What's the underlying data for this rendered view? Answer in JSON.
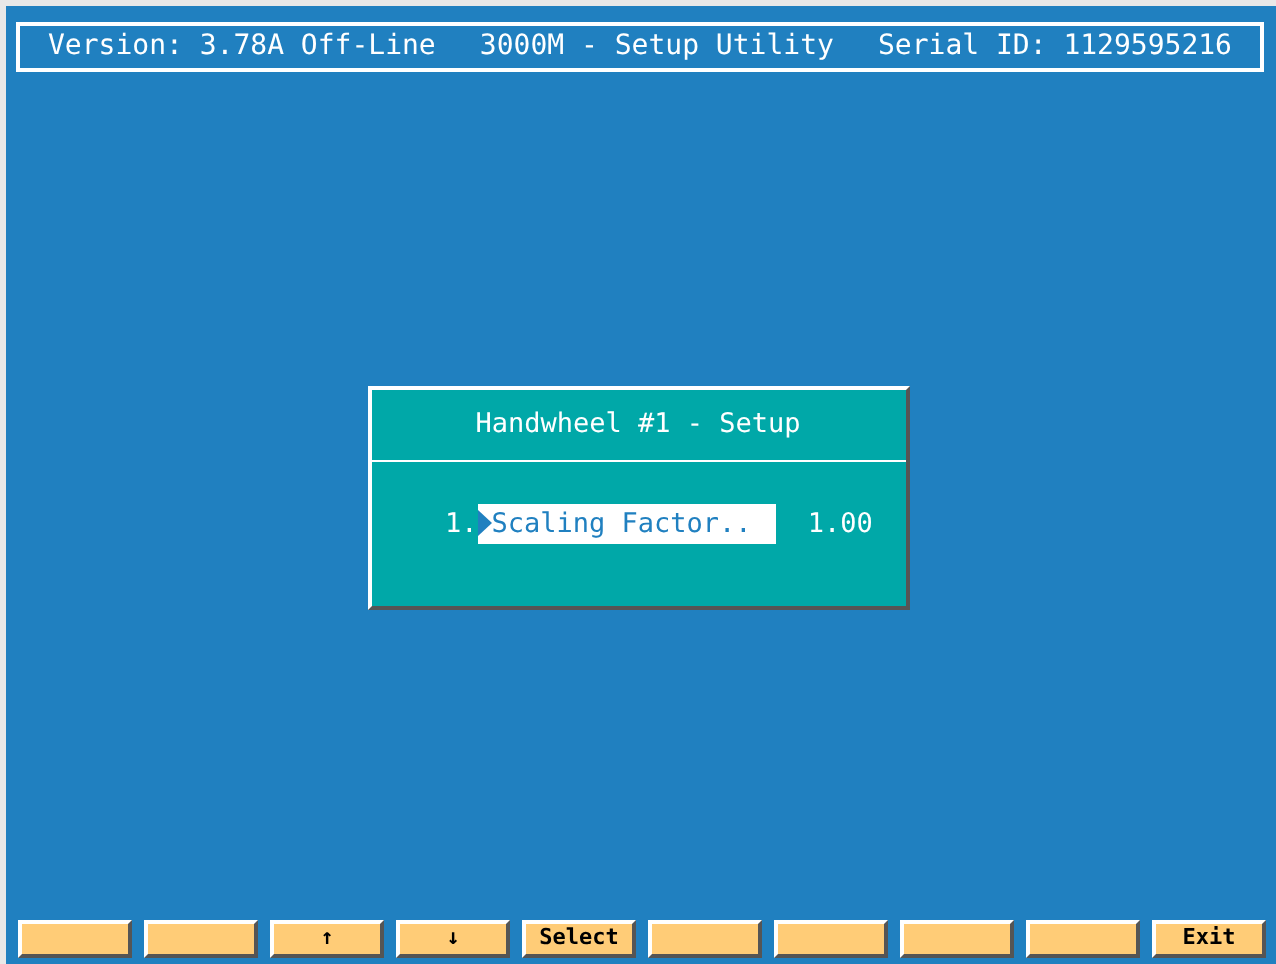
{
  "header": {
    "version": "Version: 3.78A Off-Line",
    "title": "3000M - Setup Utility",
    "serial": "Serial ID: 1129595216"
  },
  "dialog": {
    "title": "Handwheel #1 - Setup",
    "items": [
      {
        "number": "1.",
        "label": "Scaling Factor..",
        "value": "1.00",
        "selected": true
      }
    ]
  },
  "function_keys": [
    {
      "kind": "blank"
    },
    {
      "kind": "blank"
    },
    {
      "kind": "key",
      "label": "↑"
    },
    {
      "kind": "key",
      "label": "↓"
    },
    {
      "kind": "key",
      "label": "Select"
    },
    {
      "kind": "blank"
    },
    {
      "kind": "blank"
    },
    {
      "kind": "blank"
    },
    {
      "kind": "blank"
    },
    {
      "kind": "key",
      "label": "Exit"
    }
  ]
}
